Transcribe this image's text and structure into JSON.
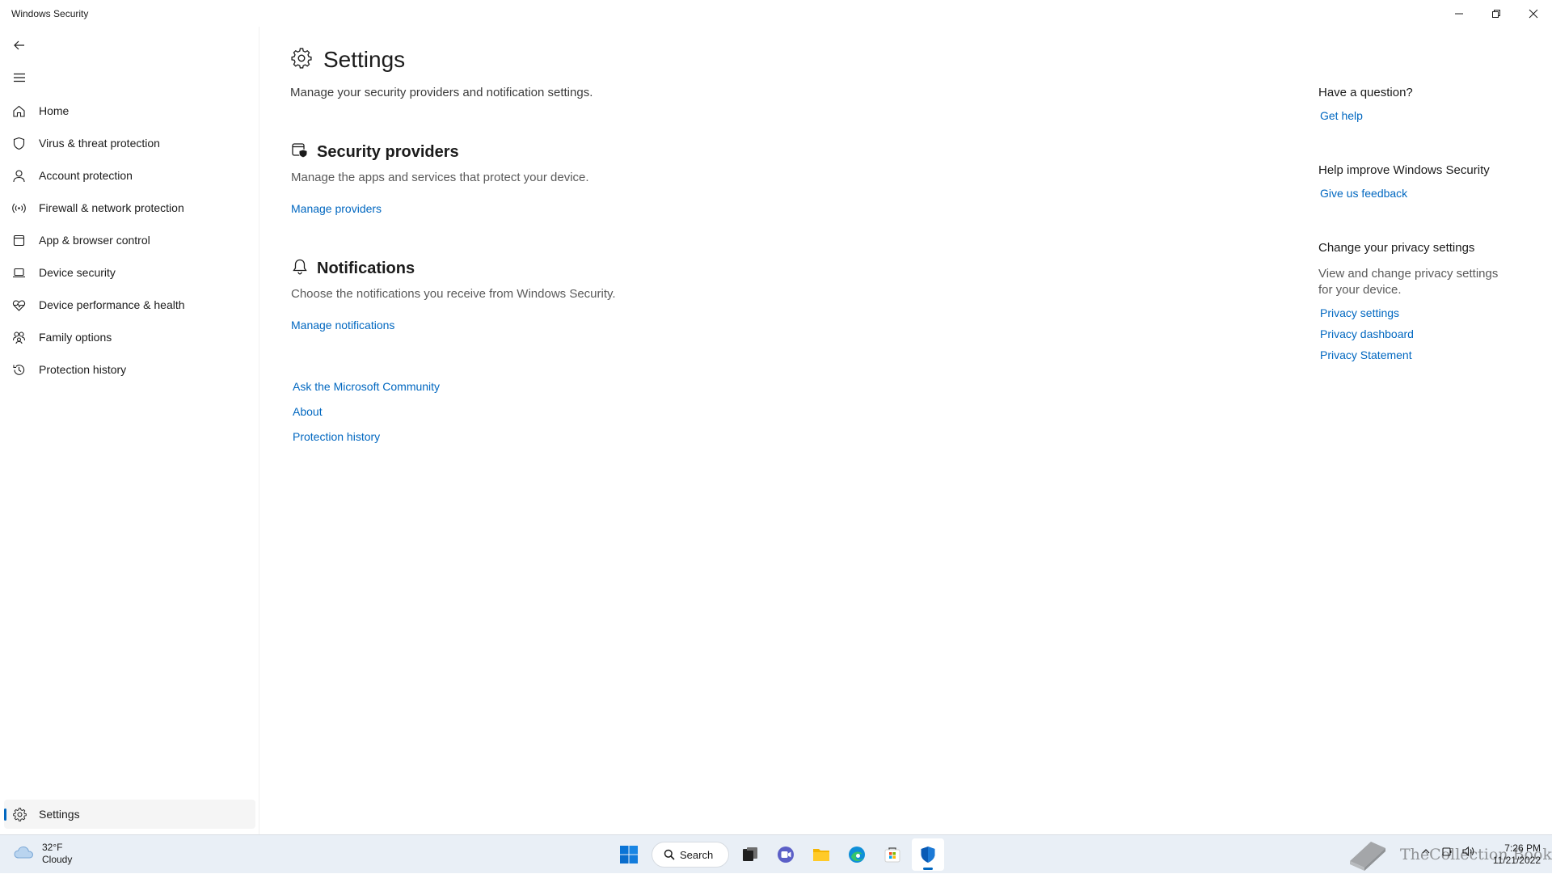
{
  "window": {
    "title": "Windows Security"
  },
  "sidebar": {
    "items": [
      {
        "label": "Home",
        "icon": "home-icon"
      },
      {
        "label": "Virus & threat protection",
        "icon": "shield-icon"
      },
      {
        "label": "Account protection",
        "icon": "person-icon"
      },
      {
        "label": "Firewall & network protection",
        "icon": "wifi-antenna-icon"
      },
      {
        "label": "App & browser control",
        "icon": "app-window-icon"
      },
      {
        "label": "Device security",
        "icon": "laptop-icon"
      },
      {
        "label": "Device performance & health",
        "icon": "heart-pulse-icon"
      },
      {
        "label": "Family options",
        "icon": "family-icon"
      },
      {
        "label": "Protection history",
        "icon": "history-icon"
      }
    ],
    "settings_label": "Settings"
  },
  "main": {
    "title": "Settings",
    "description": "Manage your security providers and notification settings.",
    "sections": [
      {
        "title": "Security providers",
        "description": "Manage the apps and services that protect your device.",
        "link": "Manage providers"
      },
      {
        "title": "Notifications",
        "description": "Choose the notifications you receive from Windows Security.",
        "link": "Manage notifications"
      }
    ],
    "links": [
      "Ask the Microsoft Community",
      "About",
      "Protection history"
    ]
  },
  "right_panel": {
    "question_heading": "Have a question?",
    "get_help": "Get help",
    "improve_heading": "Help improve Windows Security",
    "feedback": "Give us feedback",
    "privacy_heading": "Change your privacy settings",
    "privacy_desc": "View and change privacy settings for your  device.",
    "privacy_links": [
      "Privacy settings",
      "Privacy dashboard",
      "Privacy Statement"
    ]
  },
  "taskbar": {
    "weather_temp": "32°F",
    "weather_desc": "Cloudy",
    "search_label": "Search",
    "watermark": "TheCollection Book",
    "time": "7:26 PM",
    "date": "11/21/2022"
  },
  "colors": {
    "accent": "#0067c0",
    "taskbar": "#e9eff6"
  }
}
